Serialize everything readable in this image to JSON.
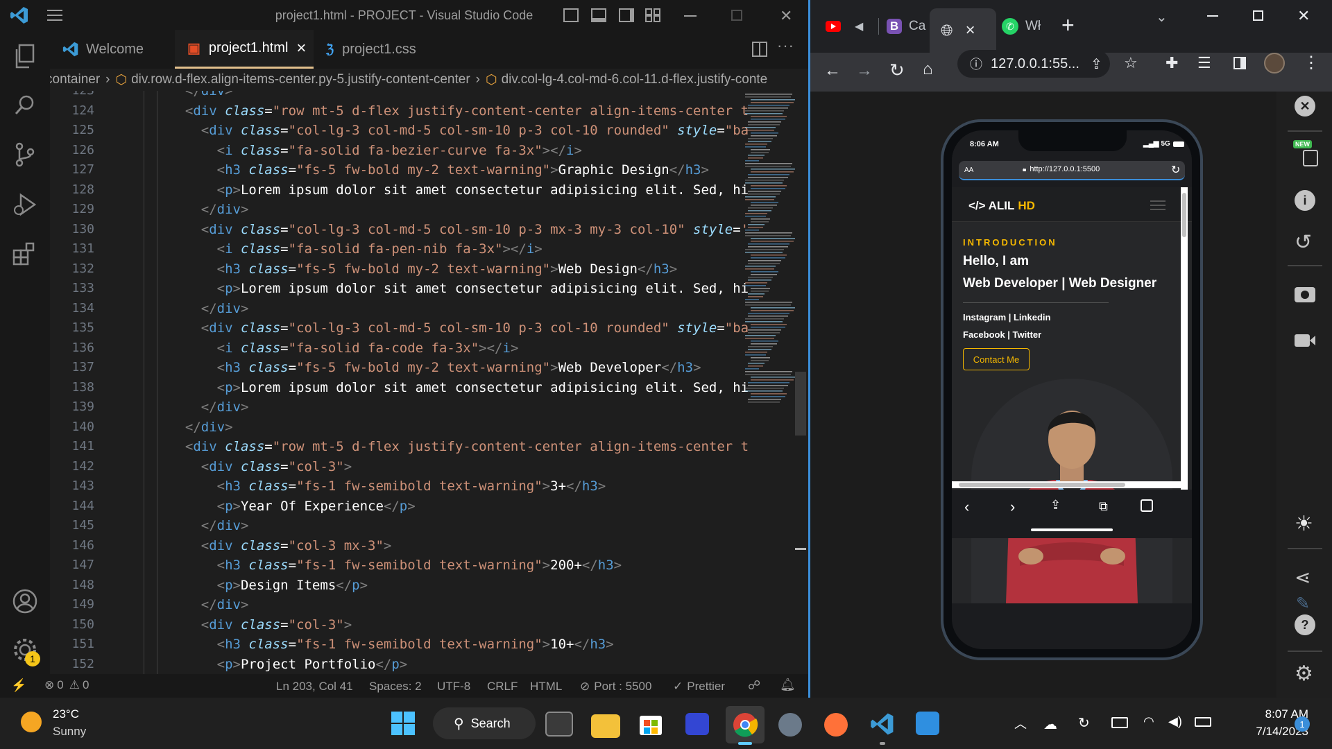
{
  "vscode": {
    "window_title": "project1.html - PROJECT - Visual Studio Code",
    "tabs": [
      {
        "label": "Welcome"
      },
      {
        "label": "project1.html",
        "close": "×"
      },
      {
        "label": "project1.css"
      }
    ],
    "breadcrumb": [
      "container",
      "div.row.d-flex.align-items-center.py-5.justify-content-center",
      "div.col-lg-4.col-md-6.col-11.d-flex.justify-conte"
    ],
    "badge_count": "1",
    "lines": [
      {
        "n": "123",
        "parts": [
          [
            "tg",
            "  </"
          ],
          [
            "tn",
            "div"
          ],
          [
            "tg",
            ">"
          ]
        ]
      },
      {
        "n": "124",
        "parts": [
          [
            "tg",
            "  <"
          ],
          [
            "tn",
            "div"
          ],
          [
            "at",
            " class"
          ],
          [
            "tx",
            "="
          ],
          [
            "st",
            "\"row mt-5 d-flex justify-content-center align-items-center t"
          ]
        ]
      },
      {
        "n": "125",
        "parts": [
          [
            "tg",
            "    <"
          ],
          [
            "tn",
            "div"
          ],
          [
            "at",
            " class"
          ],
          [
            "tx",
            "="
          ],
          [
            "st",
            "\"col-lg-3 col-md-5 col-sm-10 p-3 col-10 rounded\""
          ],
          [
            "at",
            " style"
          ],
          [
            "tx",
            "="
          ],
          [
            "st",
            "\"ba"
          ]
        ]
      },
      {
        "n": "126",
        "parts": [
          [
            "tg",
            "      <"
          ],
          [
            "tn",
            "i"
          ],
          [
            "at",
            " class"
          ],
          [
            "tx",
            "="
          ],
          [
            "st",
            "\"fa-solid fa-bezier-curve fa-3x\""
          ],
          [
            "tg",
            "></"
          ],
          [
            "tn",
            "i"
          ],
          [
            "tg",
            ">"
          ]
        ]
      },
      {
        "n": "127",
        "parts": [
          [
            "tg",
            "      <"
          ],
          [
            "tn",
            "h3"
          ],
          [
            "at",
            " class"
          ],
          [
            "tx",
            "="
          ],
          [
            "st",
            "\"fs-5 fw-bold my-2 text-warning\""
          ],
          [
            "tg",
            ">"
          ],
          [
            "tx",
            "Graphic Design"
          ],
          [
            "tg",
            "</"
          ],
          [
            "tn",
            "h3"
          ],
          [
            "tg",
            ">"
          ]
        ]
      },
      {
        "n": "128",
        "parts": [
          [
            "tg",
            "      <"
          ],
          [
            "tn",
            "p"
          ],
          [
            "tg",
            ">"
          ],
          [
            "tx",
            "Lorem ipsum dolor sit amet consectetur adipisicing elit. Sed, hi"
          ]
        ]
      },
      {
        "n": "129",
        "parts": [
          [
            "tg",
            "    </"
          ],
          [
            "tn",
            "div"
          ],
          [
            "tg",
            ">"
          ]
        ]
      },
      {
        "n": "130",
        "parts": [
          [
            "tg",
            "    <"
          ],
          [
            "tn",
            "div"
          ],
          [
            "at",
            " class"
          ],
          [
            "tx",
            "="
          ],
          [
            "st",
            "\"col-lg-3 col-md-5 col-sm-10 p-3 mx-3 my-3 col-10\""
          ],
          [
            "at",
            " style"
          ],
          [
            "tx",
            "="
          ],
          [
            "st",
            "'"
          ]
        ]
      },
      {
        "n": "131",
        "parts": [
          [
            "tg",
            "      <"
          ],
          [
            "tn",
            "i"
          ],
          [
            "at",
            " class"
          ],
          [
            "tx",
            "="
          ],
          [
            "st",
            "\"fa-solid fa-pen-nib fa-3x\""
          ],
          [
            "tg",
            "></"
          ],
          [
            "tn",
            "i"
          ],
          [
            "tg",
            ">"
          ]
        ]
      },
      {
        "n": "132",
        "parts": [
          [
            "tg",
            "      <"
          ],
          [
            "tn",
            "h3"
          ],
          [
            "at",
            " class"
          ],
          [
            "tx",
            "="
          ],
          [
            "st",
            "\"fs-5 fw-bold my-2 text-warning\""
          ],
          [
            "tg",
            ">"
          ],
          [
            "tx",
            "Web Design"
          ],
          [
            "tg",
            "</"
          ],
          [
            "tn",
            "h3"
          ],
          [
            "tg",
            ">"
          ]
        ]
      },
      {
        "n": "133",
        "parts": [
          [
            "tg",
            "      <"
          ],
          [
            "tn",
            "p"
          ],
          [
            "tg",
            ">"
          ],
          [
            "tx",
            "Lorem ipsum dolor sit amet consectetur adipisicing elit. Sed, hi"
          ]
        ]
      },
      {
        "n": "134",
        "parts": [
          [
            "tg",
            "    </"
          ],
          [
            "tn",
            "div"
          ],
          [
            "tg",
            ">"
          ]
        ]
      },
      {
        "n": "135",
        "parts": [
          [
            "tg",
            "    <"
          ],
          [
            "tn",
            "div"
          ],
          [
            "at",
            " class"
          ],
          [
            "tx",
            "="
          ],
          [
            "st",
            "\"col-lg-3 col-md-5 col-sm-10 p-3 col-10 rounded\""
          ],
          [
            "at",
            " style"
          ],
          [
            "tx",
            "="
          ],
          [
            "st",
            "\"ba"
          ]
        ]
      },
      {
        "n": "136",
        "parts": [
          [
            "tg",
            "      <"
          ],
          [
            "tn",
            "i"
          ],
          [
            "at",
            " class"
          ],
          [
            "tx",
            "="
          ],
          [
            "st",
            "\"fa-solid fa-code fa-3x\""
          ],
          [
            "tg",
            "></"
          ],
          [
            "tn",
            "i"
          ],
          [
            "tg",
            ">"
          ]
        ]
      },
      {
        "n": "137",
        "parts": [
          [
            "tg",
            "      <"
          ],
          [
            "tn",
            "h3"
          ],
          [
            "at",
            " class"
          ],
          [
            "tx",
            "="
          ],
          [
            "st",
            "\"fs-5 fw-bold my-2 text-warning\""
          ],
          [
            "tg",
            ">"
          ],
          [
            "tx",
            "Web Developer"
          ],
          [
            "tg",
            "</"
          ],
          [
            "tn",
            "h3"
          ],
          [
            "tg",
            ">"
          ]
        ]
      },
      {
        "n": "138",
        "parts": [
          [
            "tg",
            "      <"
          ],
          [
            "tn",
            "p"
          ],
          [
            "tg",
            ">"
          ],
          [
            "tx",
            "Lorem ipsum dolor sit amet consectetur adipisicing elit. Sed, hi"
          ]
        ]
      },
      {
        "n": "139",
        "parts": [
          [
            "tg",
            "    </"
          ],
          [
            "tn",
            "div"
          ],
          [
            "tg",
            ">"
          ]
        ]
      },
      {
        "n": "140",
        "parts": [
          [
            "tg",
            "  </"
          ],
          [
            "tn",
            "div"
          ],
          [
            "tg",
            ">"
          ]
        ]
      },
      {
        "n": "141",
        "parts": [
          [
            "tg",
            "  <"
          ],
          [
            "tn",
            "div"
          ],
          [
            "at",
            " class"
          ],
          [
            "tx",
            "="
          ],
          [
            "st",
            "\"row mt-5 d-flex justify-content-center align-items-center t"
          ]
        ]
      },
      {
        "n": "142",
        "parts": [
          [
            "tg",
            "    <"
          ],
          [
            "tn",
            "div"
          ],
          [
            "at",
            " class"
          ],
          [
            "tx",
            "="
          ],
          [
            "st",
            "\"col-3\""
          ],
          [
            "tg",
            ">"
          ]
        ]
      },
      {
        "n": "143",
        "parts": [
          [
            "tg",
            "      <"
          ],
          [
            "tn",
            "h3"
          ],
          [
            "at",
            " class"
          ],
          [
            "tx",
            "="
          ],
          [
            "st",
            "\"fs-1 fw-semibold text-warning\""
          ],
          [
            "tg",
            ">"
          ],
          [
            "tx",
            "3+"
          ],
          [
            "tg",
            "</"
          ],
          [
            "tn",
            "h3"
          ],
          [
            "tg",
            ">"
          ]
        ]
      },
      {
        "n": "144",
        "parts": [
          [
            "tg",
            "      <"
          ],
          [
            "tn",
            "p"
          ],
          [
            "tg",
            ">"
          ],
          [
            "tx",
            "Year Of Experience"
          ],
          [
            "tg",
            "</"
          ],
          [
            "tn",
            "p"
          ],
          [
            "tg",
            ">"
          ]
        ]
      },
      {
        "n": "145",
        "parts": [
          [
            "tg",
            "    </"
          ],
          [
            "tn",
            "div"
          ],
          [
            "tg",
            ">"
          ]
        ]
      },
      {
        "n": "146",
        "parts": [
          [
            "tg",
            "    <"
          ],
          [
            "tn",
            "div"
          ],
          [
            "at",
            " class"
          ],
          [
            "tx",
            "="
          ],
          [
            "st",
            "\"col-3 mx-3\""
          ],
          [
            "tg",
            ">"
          ]
        ]
      },
      {
        "n": "147",
        "parts": [
          [
            "tg",
            "      <"
          ],
          [
            "tn",
            "h3"
          ],
          [
            "at",
            " class"
          ],
          [
            "tx",
            "="
          ],
          [
            "st",
            "\"fs-1 fw-semibold text-warning\""
          ],
          [
            "tg",
            ">"
          ],
          [
            "tx",
            "200+"
          ],
          [
            "tg",
            "</"
          ],
          [
            "tn",
            "h3"
          ],
          [
            "tg",
            ">"
          ]
        ]
      },
      {
        "n": "148",
        "parts": [
          [
            "tg",
            "      <"
          ],
          [
            "tn",
            "p"
          ],
          [
            "tg",
            ">"
          ],
          [
            "tx",
            "Design Items"
          ],
          [
            "tg",
            "</"
          ],
          [
            "tn",
            "p"
          ],
          [
            "tg",
            ">"
          ]
        ]
      },
      {
        "n": "149",
        "parts": [
          [
            "tg",
            "    </"
          ],
          [
            "tn",
            "div"
          ],
          [
            "tg",
            ">"
          ]
        ]
      },
      {
        "n": "150",
        "parts": [
          [
            "tg",
            "    <"
          ],
          [
            "tn",
            "div"
          ],
          [
            "at",
            " class"
          ],
          [
            "tx",
            "="
          ],
          [
            "st",
            "\"col-3\""
          ],
          [
            "tg",
            ">"
          ]
        ]
      },
      {
        "n": "151",
        "parts": [
          [
            "tg",
            "      <"
          ],
          [
            "tn",
            "h3"
          ],
          [
            "at",
            " class"
          ],
          [
            "tx",
            "="
          ],
          [
            "st",
            "\"fs-1 fw-semibold text-warning\""
          ],
          [
            "tg",
            ">"
          ],
          [
            "tx",
            "10+"
          ],
          [
            "tg",
            "</"
          ],
          [
            "tn",
            "h3"
          ],
          [
            "tg",
            ">"
          ]
        ]
      },
      {
        "n": "152",
        "parts": [
          [
            "tg",
            "      <"
          ],
          [
            "tn",
            "p"
          ],
          [
            "tg",
            ">"
          ],
          [
            "tx",
            "Project Portfolio"
          ],
          [
            "tg",
            "</"
          ],
          [
            "tn",
            "p"
          ],
          [
            "tg",
            ">"
          ]
        ]
      }
    ],
    "status": {
      "errors": "0",
      "warnings": "0",
      "position": "Ln 203, Col 41",
      "spaces": "Spaces: 2",
      "encoding": "UTF-8",
      "eol": "CRLF",
      "language": "HTML",
      "port": "Port : 5500",
      "prettier": "Prettier"
    }
  },
  "browser": {
    "tabs": [
      {
        "label": "Ca"
      },
      {
        "label": "",
        "close": "×"
      },
      {
        "label": "Wł"
      }
    ],
    "new_tab": "+",
    "address": "127.0.0.1:55...",
    "phone": {
      "time": "8:06 AM",
      "signal": "5G",
      "aa": "AA",
      "url": "http://127.0.0.1:5500",
      "brand_prefix": "</>",
      "brand_name": "ALIL",
      "brand_suffix": "HD",
      "intro": "INTRODUCTION",
      "hello": "Hello, I am",
      "role": "Web Developer | Web Designer",
      "social_line1": "Instagram | Linkedin",
      "social_line2": "Facebook | Twitter",
      "cta": "Contact Me"
    },
    "devtools_badge": "NEW"
  },
  "taskbar": {
    "temperature": "23°C",
    "weather": "Sunny",
    "search": "Search",
    "time": "8:07 AM",
    "date": "7/14/2023",
    "notification_count": "1"
  },
  "colors": {
    "accent_yellow": "#f5b800",
    "vscode_blue": "#3c9bd6",
    "tab_active_border": "#e2c08d"
  }
}
